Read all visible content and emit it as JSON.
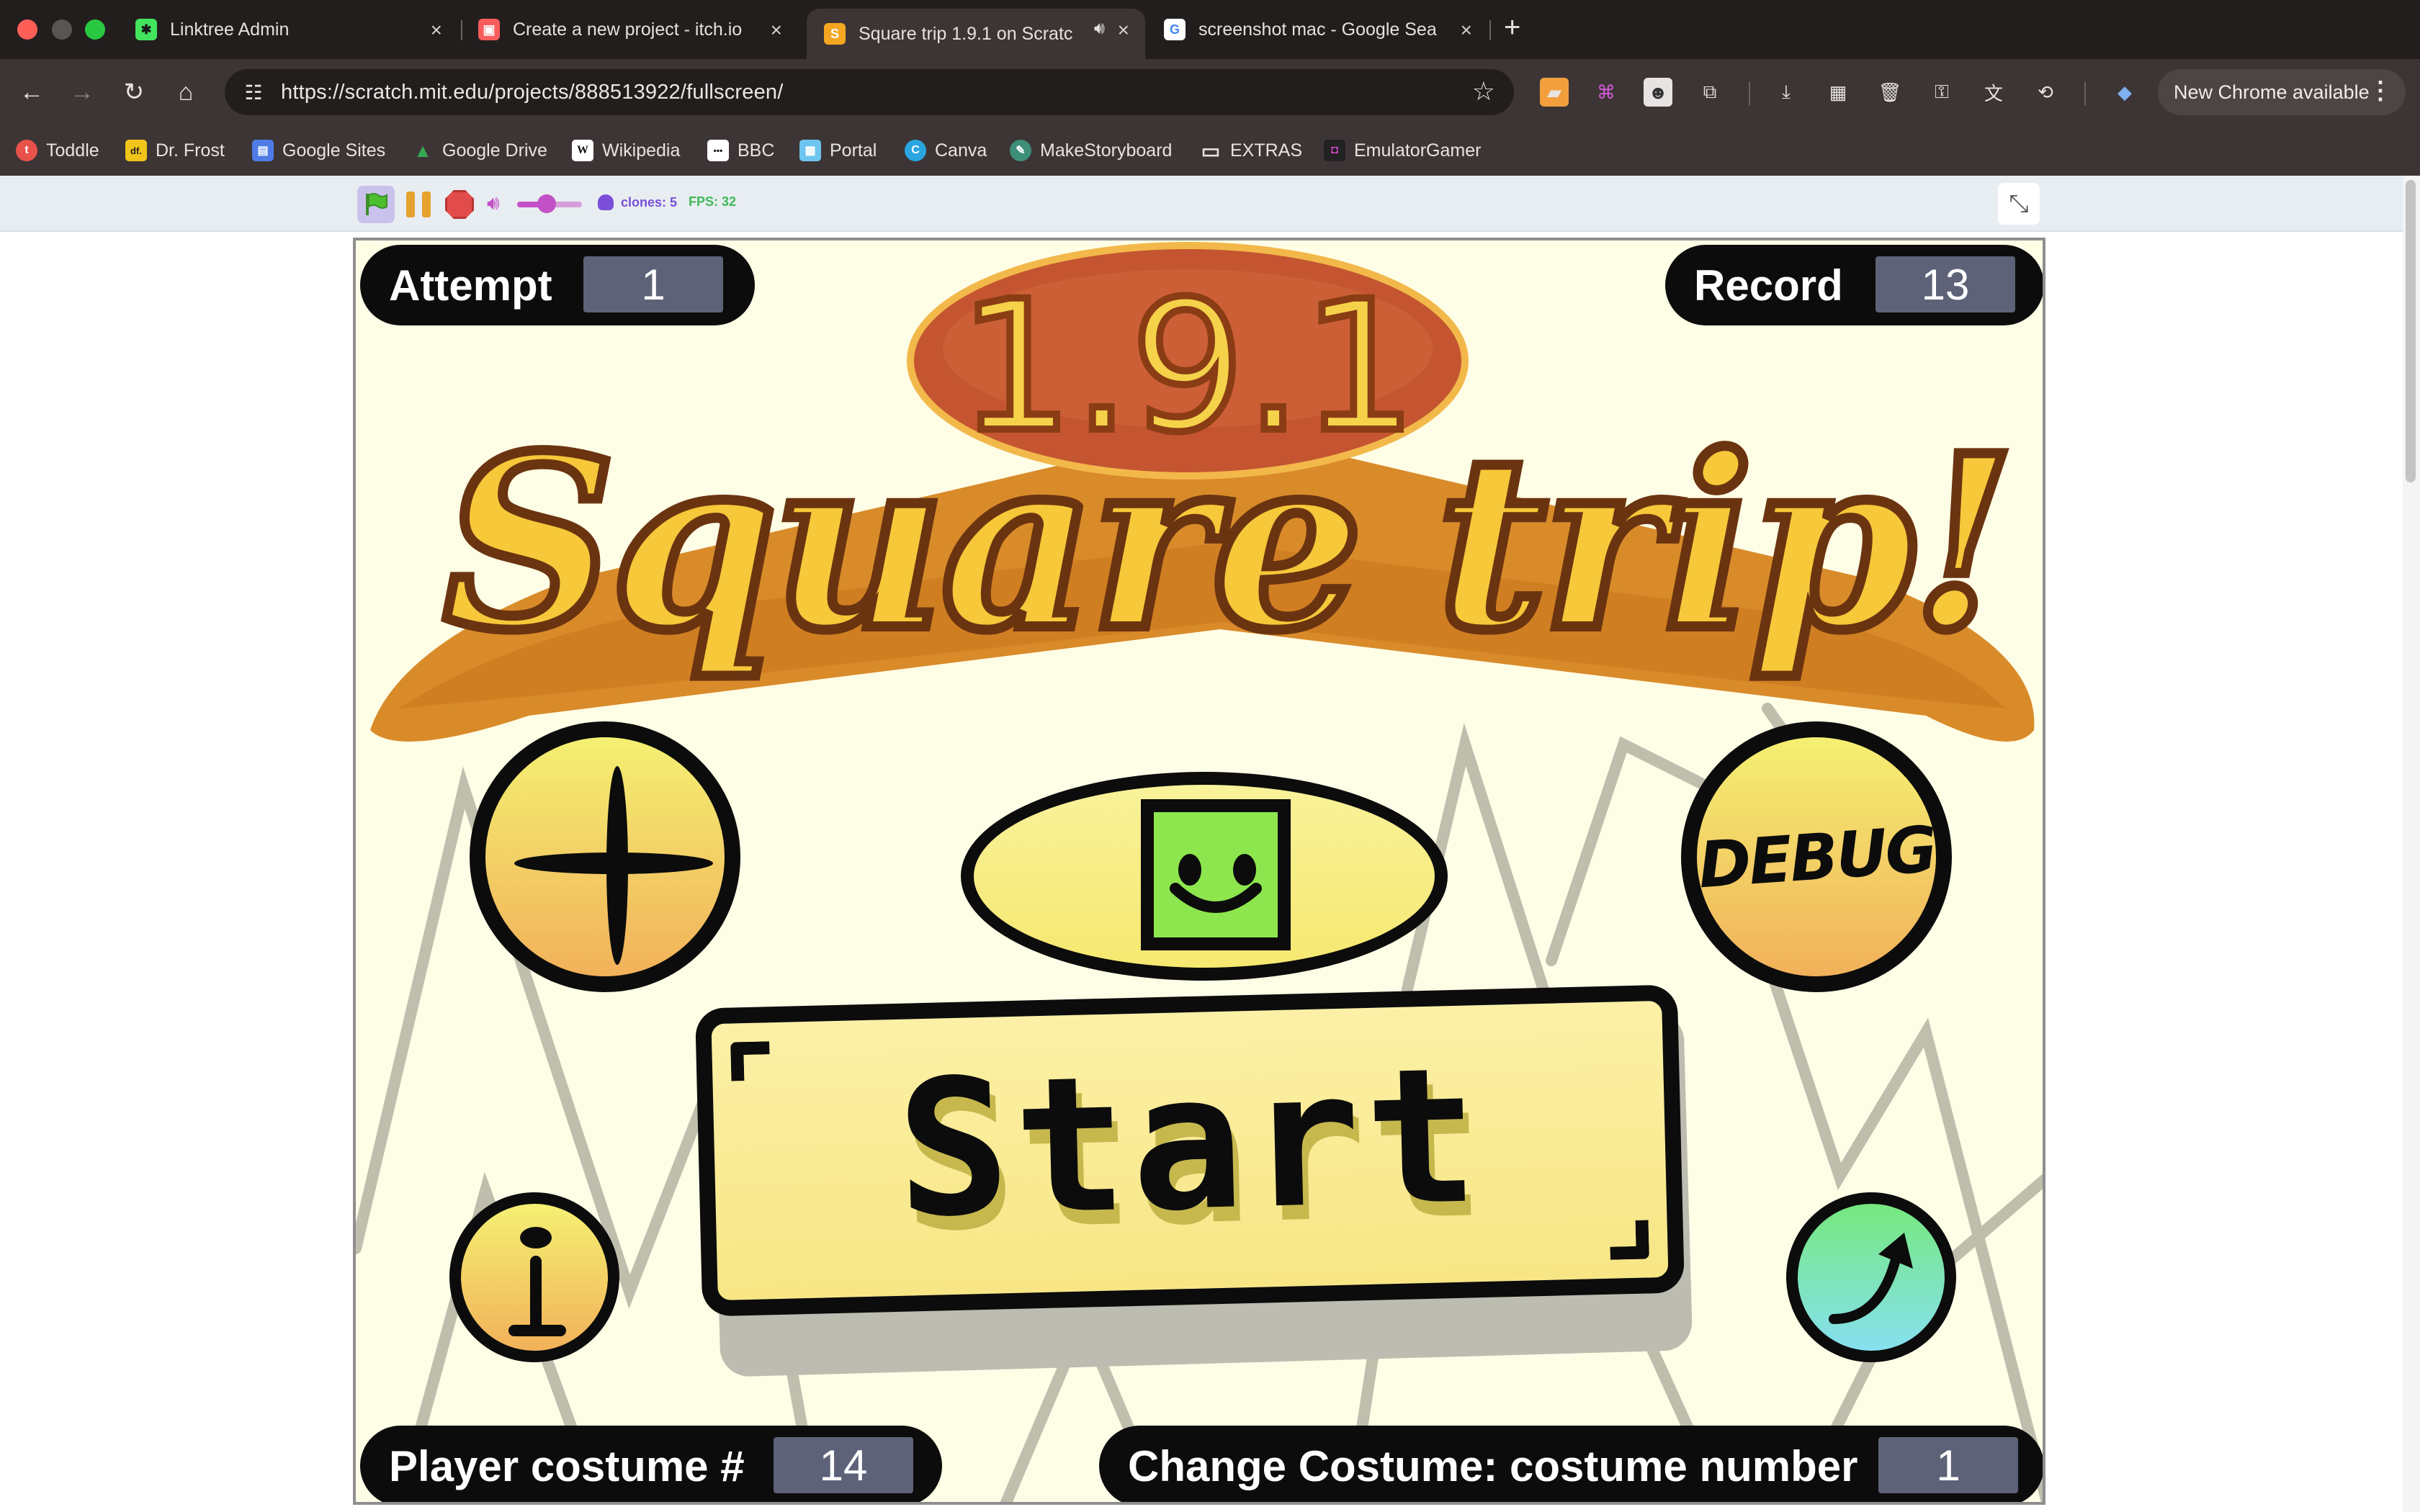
{
  "browser": {
    "tabs": [
      {
        "title": "Linktree Admin",
        "favicon_color": "#43e55e",
        "favicon_glyph": "✱"
      },
      {
        "title": "Create a new project - itch.io",
        "favicon_color": "#fa5c5c",
        "favicon_glyph": "▣"
      },
      {
        "title": "Square trip 1.9.1 on Scratc",
        "favicon_color": "#f5a623",
        "favicon_glyph": "S",
        "active": true
      },
      {
        "title": "screenshot mac - Google Sea",
        "favicon_color": "#ffffff",
        "favicon_glyph": "G"
      }
    ],
    "url": "https://scratch.mit.edu/projects/888513922/fullscreen/",
    "update_label": "New Chrome available",
    "bookmarks": [
      {
        "label": "Toddle",
        "color": "#e8524a",
        "glyph": "t"
      },
      {
        "label": "Dr. Frost",
        "color": "#f0c419",
        "glyph": "df."
      },
      {
        "label": "Google Sites",
        "color": "#4e7be6",
        "glyph": "▤"
      },
      {
        "label": "Google Drive",
        "color": "#34a853",
        "glyph": "▲"
      },
      {
        "label": "Wikipedia",
        "color": "#ffffff",
        "glyph": "W"
      },
      {
        "label": "BBC",
        "color": "#ffffff",
        "glyph": "▪▪▪"
      },
      {
        "label": "Portal",
        "color": "#6ec6f0",
        "glyph": "▦"
      },
      {
        "label": "Canva",
        "color": "#2aa5e0",
        "glyph": "C"
      },
      {
        "label": "MakeStoryboard",
        "color": "#3d8f78",
        "glyph": "✎"
      },
      {
        "label": "EXTRAS",
        "color": "#3d3535",
        "glyph": "▭"
      },
      {
        "label": "EmulatorGamer",
        "color": "#222222",
        "glyph": "◘"
      }
    ]
  },
  "player": {
    "clones_label": "clones: 5",
    "fps_label": "FPS: 32",
    "volume_fraction": 0.45
  },
  "game": {
    "attempt_label": "Attempt",
    "attempt_value": "1",
    "record_label": "Record",
    "record_value": "13",
    "version_text": "1.9.1",
    "title_text": "Square trip!",
    "debug_label": "DEBUG",
    "start_label": "Start",
    "player_costume_label": "Player costume #",
    "player_costume_value": "14",
    "change_costume_label": "Change Costume: costume number",
    "change_costume_value": "1"
  }
}
